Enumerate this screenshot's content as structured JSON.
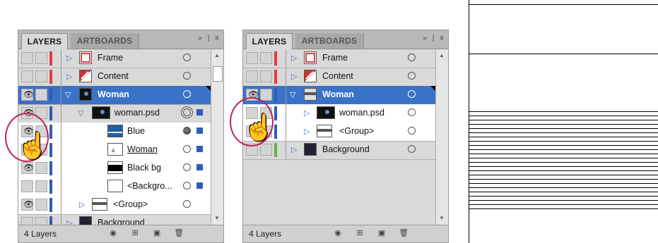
{
  "left_panel": {
    "tabs": {
      "active": "LAYERS",
      "inactive": "ARTBOARDS"
    },
    "menu_icons": [
      "»",
      "|",
      "≡"
    ],
    "rows": [
      {
        "label": "Frame",
        "color": "#e83a3a",
        "eye": false,
        "expanded": false,
        "thumb": "frame"
      },
      {
        "label": "Content",
        "color": "#e83a3a",
        "eye": false,
        "expanded": false,
        "thumb": "content"
      },
      {
        "label": "Woman",
        "color": "#2d5db8",
        "eye": true,
        "expanded": true,
        "thumb": "woman",
        "selected": true
      },
      {
        "label": "woman.psd",
        "color": "#2d5db8",
        "eye": true,
        "expanded": true,
        "thumb": "psd"
      },
      {
        "label": "Blue",
        "color": "#2d5db8",
        "eye": true,
        "thumb": "blue"
      },
      {
        "label": "Woman",
        "color": "#2d5db8",
        "eye": false,
        "thumb": "text"
      },
      {
        "label": "Black bg",
        "color": "#2d5db8",
        "eye": true,
        "thumb": "black"
      },
      {
        "label": "<Backgro...",
        "color": "#2d5db8",
        "eye": false,
        "thumb": "white"
      },
      {
        "label": "<Group>",
        "color": "#2d5db8",
        "eye": true,
        "expanded": false,
        "thumb": "group"
      },
      {
        "label": "Background",
        "color": "#2d5db8",
        "eye": false,
        "expanded": false,
        "thumb": "bg"
      }
    ],
    "status": "4 Layers"
  },
  "right_panel": {
    "tabs": {
      "active": "LAYERS",
      "inactive": "ARTBOARDS"
    },
    "menu_icons": [
      "»",
      "|",
      "≡"
    ],
    "rows": [
      {
        "label": "Frame",
        "color": "#e83a3a",
        "eye": false,
        "expanded": false,
        "thumb": "frame"
      },
      {
        "label": "Content",
        "color": "#e83a3a",
        "eye": false,
        "expanded": false,
        "thumb": "content"
      },
      {
        "label": "Woman",
        "color": "#2d5db8",
        "eye": false,
        "expanded": true,
        "thumb": "woman",
        "selected": true
      },
      {
        "label": "woman.psd",
        "color": "#2d5db8",
        "eye": false,
        "expanded": false,
        "thumb": "psd"
      },
      {
        "label": "<Group>",
        "color": "#2d5db8",
        "eye": false,
        "expanded": false,
        "thumb": "group"
      },
      {
        "label": "Background",
        "color": "#62b44a",
        "eye": false,
        "expanded": false,
        "thumb": "bg"
      }
    ],
    "status": "4 Layers"
  },
  "status_icon_names": [
    "make-clipping-mask-icon",
    "create-sublayer-icon",
    "new-layer-icon",
    "delete-icon"
  ]
}
